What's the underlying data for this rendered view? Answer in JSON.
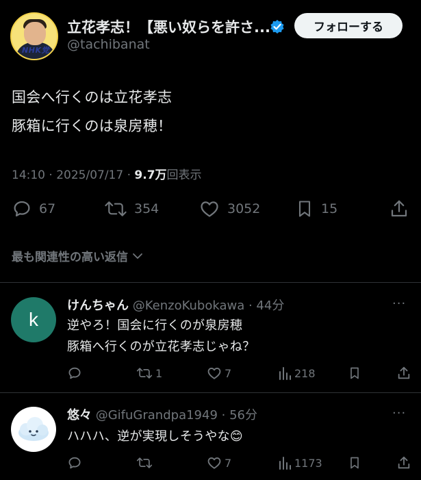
{
  "author": {
    "display_name": "立花孝志！【悪い奴らを許さ...",
    "handle": "@tachibanat",
    "avatar_badge": "NHK党",
    "verified_icon": "verified-badge-icon",
    "follow_label": "フォローする"
  },
  "tweet": {
    "lines": [
      "国会へ行くのは立花孝志",
      "豚箱に行くのは泉房穂！"
    ],
    "time": "14:10 · 2025/07/17 · ",
    "views_count": "9.7万",
    "views_label": "回表示"
  },
  "stats": {
    "replies": "67",
    "retweets": "354",
    "likes": "3052",
    "bookmarks": "15"
  },
  "best_replies_label": "最も関連性の高い返信",
  "replies": [
    {
      "name": "けんちゃん",
      "handle": "@KenzoKubokawa",
      "time": "· 44分",
      "avatar_letter": "k",
      "lines": [
        "逆やろ！国会に行くのが泉房穂",
        "豚箱へ行くのが立花孝志じゃね？"
      ],
      "retweets": "1",
      "likes": "7",
      "views": "218",
      "more": "···"
    },
    {
      "name": "悠々",
      "handle": "@GifuGrandpa1949",
      "time": "· 56分",
      "lines": [
        "ハハハ、逆が実現しそうやな😊"
      ],
      "likes": "7",
      "views": "1173",
      "more": "···"
    }
  ],
  "colors": {
    "background": "#000000",
    "text": "#e7e9ea",
    "muted": "#71767b",
    "verified": "#1d9bf0",
    "avatar_k": "#1f7a69"
  }
}
